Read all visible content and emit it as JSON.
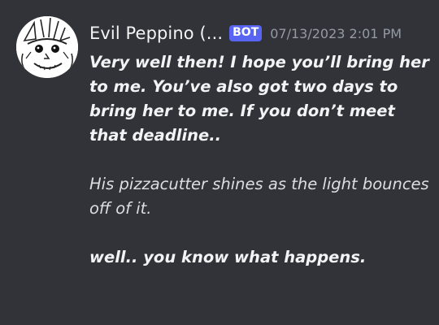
{
  "message": {
    "author": {
      "name": "Evil Peppino (...",
      "bot_tag": "BOT",
      "avatar_icon": "evil-peppino-avatar"
    },
    "timestamp": "07/13/2023 2:01 PM",
    "paragraphs": {
      "line1": "Very well then! I hope you’ll bring her to me. You’ve also got two days to bring her to me. If you don’t meet that deadline..",
      "line2": "His pizzacutter shines as the light bounces off of it.",
      "line3": "well.. you know what happens."
    }
  },
  "colors": {
    "background": "#313338",
    "bot_tag": "#5865f2",
    "timestamp": "#949ba4",
    "text": "#dbdee1"
  }
}
